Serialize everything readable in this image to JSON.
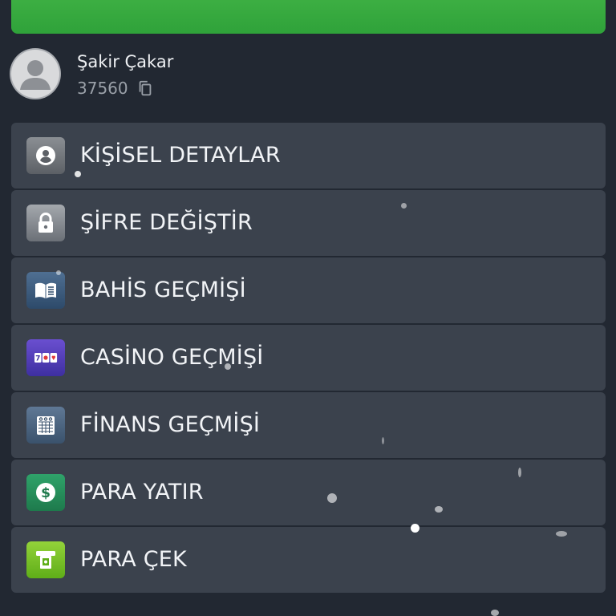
{
  "profile": {
    "name": "Şakir Çakar",
    "id": "37560"
  },
  "menu": {
    "items": [
      {
        "label": "KİŞİSEL DETAYLAR",
        "icon": "user-circle-icon"
      },
      {
        "label": "ŞİFRE DEĞİŞTİR",
        "icon": "lock-icon"
      },
      {
        "label": "BAHİS GEÇMİŞİ",
        "icon": "book-icon"
      },
      {
        "label": "CASİNO GEÇMİŞİ",
        "icon": "slot-machine-icon"
      },
      {
        "label": "FİNANS GEÇMİŞİ",
        "icon": "calendar-grid-icon"
      },
      {
        "label": "PARA YATIR",
        "icon": "dollar-coin-icon"
      },
      {
        "label": "PARA ÇEK",
        "icon": "atm-cash-icon"
      }
    ]
  },
  "colors": {
    "background": "#222832",
    "banner": "#3fb144",
    "item": "#3b424d",
    "text": "#f2f4f7",
    "muted": "#9aa0a8"
  }
}
